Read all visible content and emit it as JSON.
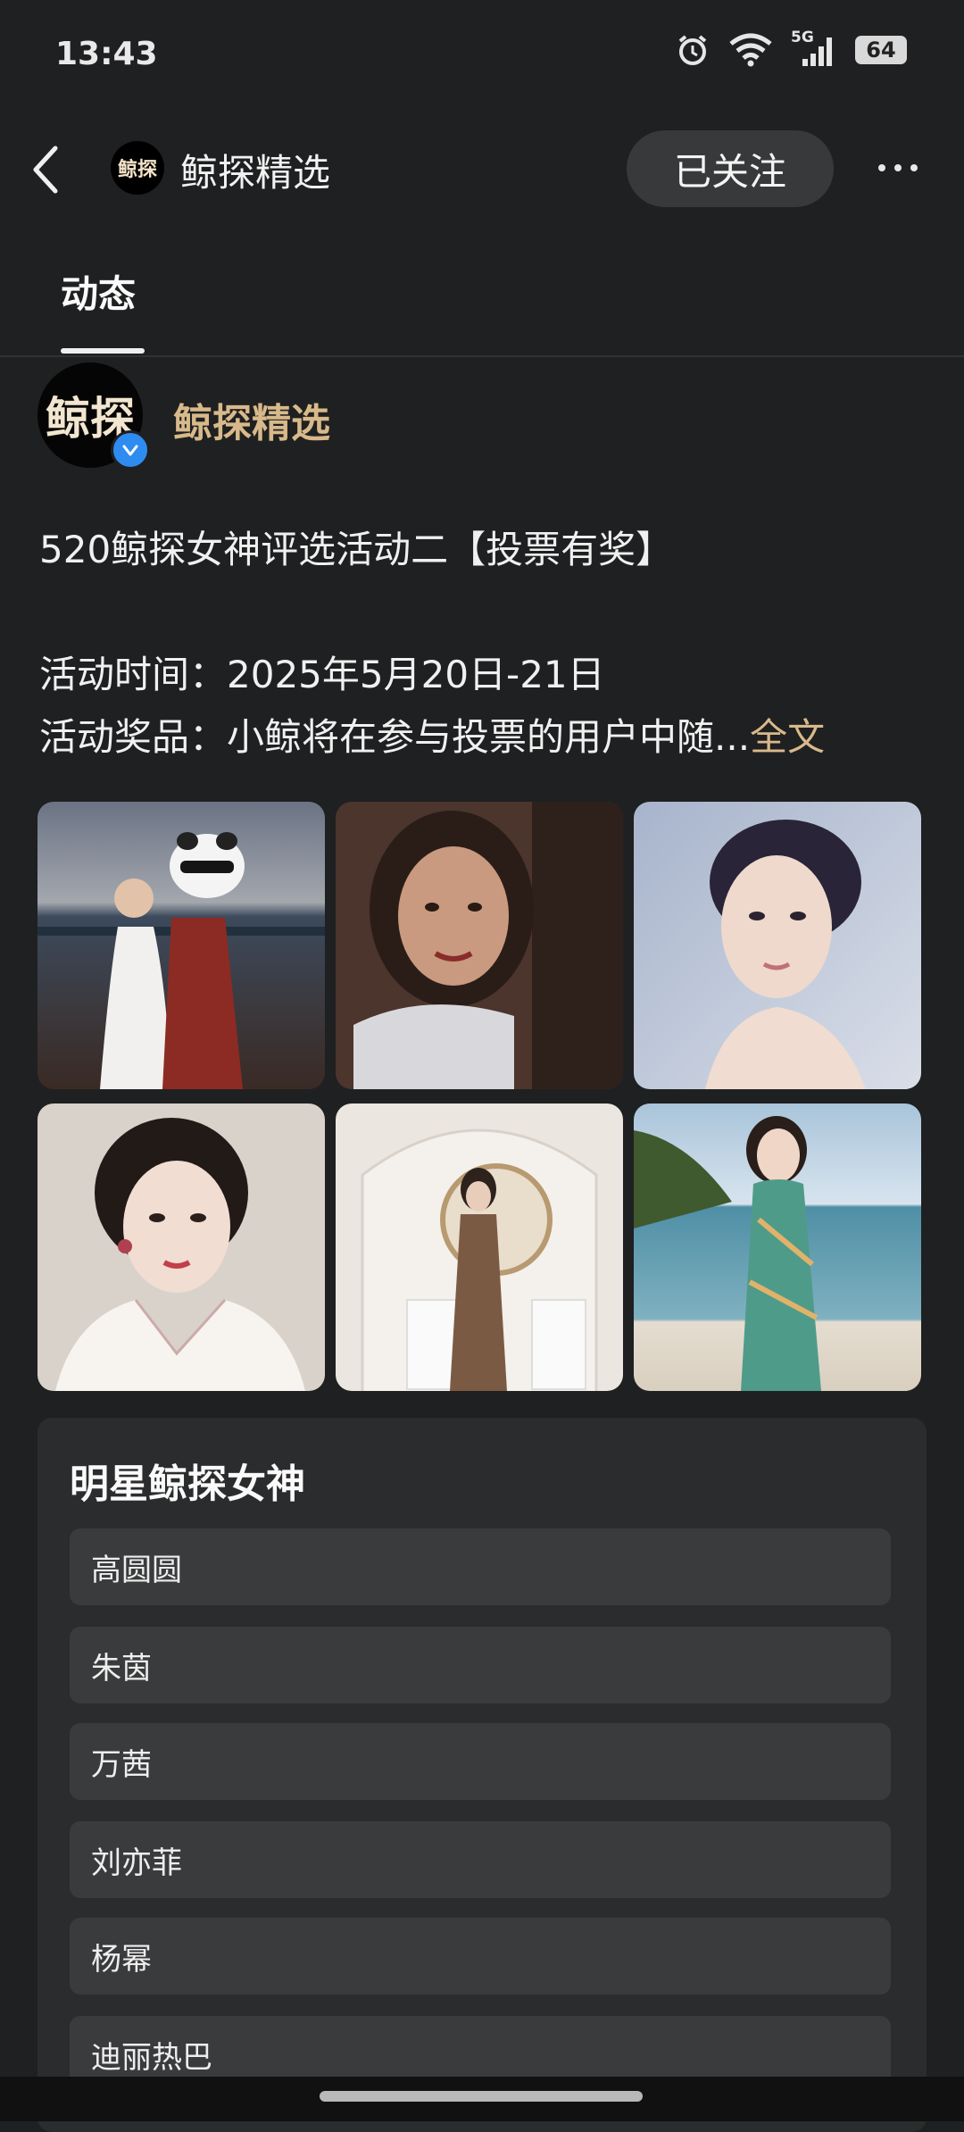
{
  "status_bar": {
    "time": "13:43",
    "network": "5G",
    "battery": "64"
  },
  "header": {
    "avatar_text": "鲸探",
    "title": "鲸探精选",
    "follow_label": "已关注"
  },
  "tabs": [
    {
      "label": "动态",
      "active": true
    }
  ],
  "post": {
    "author_avatar_text": "鲸探",
    "author": "鲸探精选",
    "title_line": "520鲸探女神评选活动二【投票有奖】",
    "line_time": "活动时间：2025年5月20日-21日",
    "line_prize": "活动奖品：小鲸将在参与投票的用户中随...",
    "more_label": "全文"
  },
  "poll": {
    "title": "明星鲸探女神",
    "options": [
      "高圆圆",
      "朱茵",
      "万茜",
      "刘亦菲",
      "杨幂",
      "迪丽热巴"
    ]
  },
  "colors": {
    "accent_gold": "#d8b98a",
    "verified_blue": "#2e8cf0",
    "background": "#1f2021"
  }
}
